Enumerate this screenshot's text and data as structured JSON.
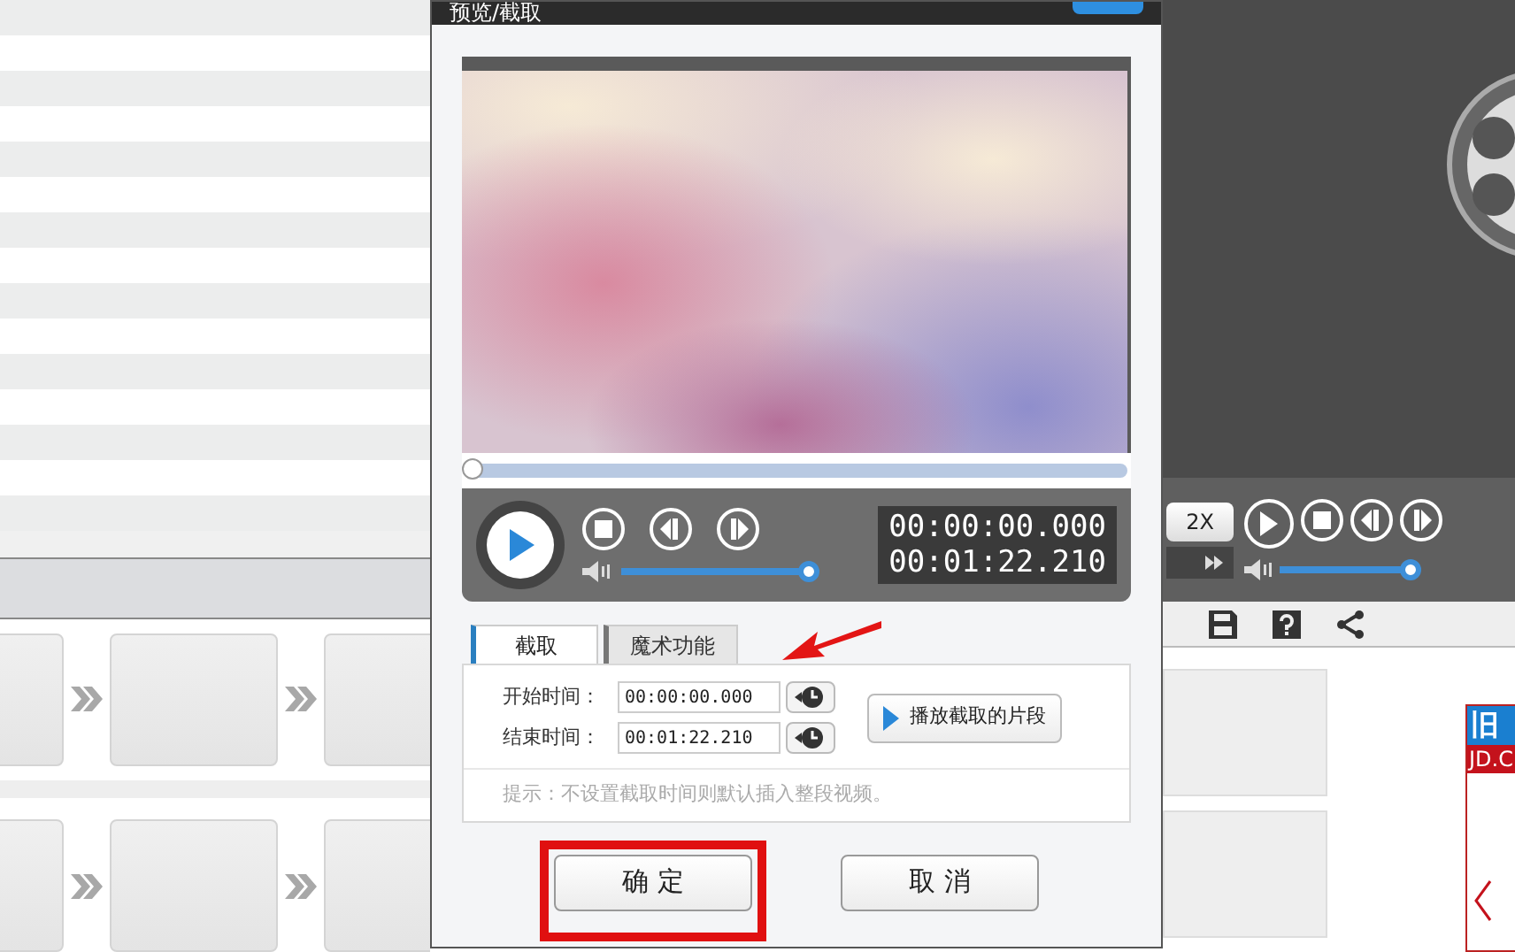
{
  "dialog": {
    "title": "预览/截取",
    "seek": {
      "level": 0
    },
    "time_display": {
      "current": "00:00:00.000",
      "total": "00:01:22.210"
    },
    "volume": {
      "level": 1
    },
    "tabs": [
      {
        "label": "截取",
        "selected": true
      },
      {
        "label": "魔术功能",
        "selected": false
      }
    ],
    "fields": [
      {
        "label": "开始时间：",
        "value": "00:00:00.000"
      },
      {
        "label": "结束时间：",
        "value": "00:01:22.210"
      }
    ],
    "play_clip_button": "播放截取的片段",
    "hint": "提示：不设置截取时间则默认插入整段视频。",
    "buttons": [
      {
        "label": "确 定",
        "highlighted": true
      },
      {
        "label": "取 消",
        "highlighted": false
      }
    ]
  },
  "player": {
    "speed": "2X",
    "volume": {
      "level": 1
    }
  },
  "ad_card": {
    "title": "旧",
    "subtitle": "JD.C"
  }
}
